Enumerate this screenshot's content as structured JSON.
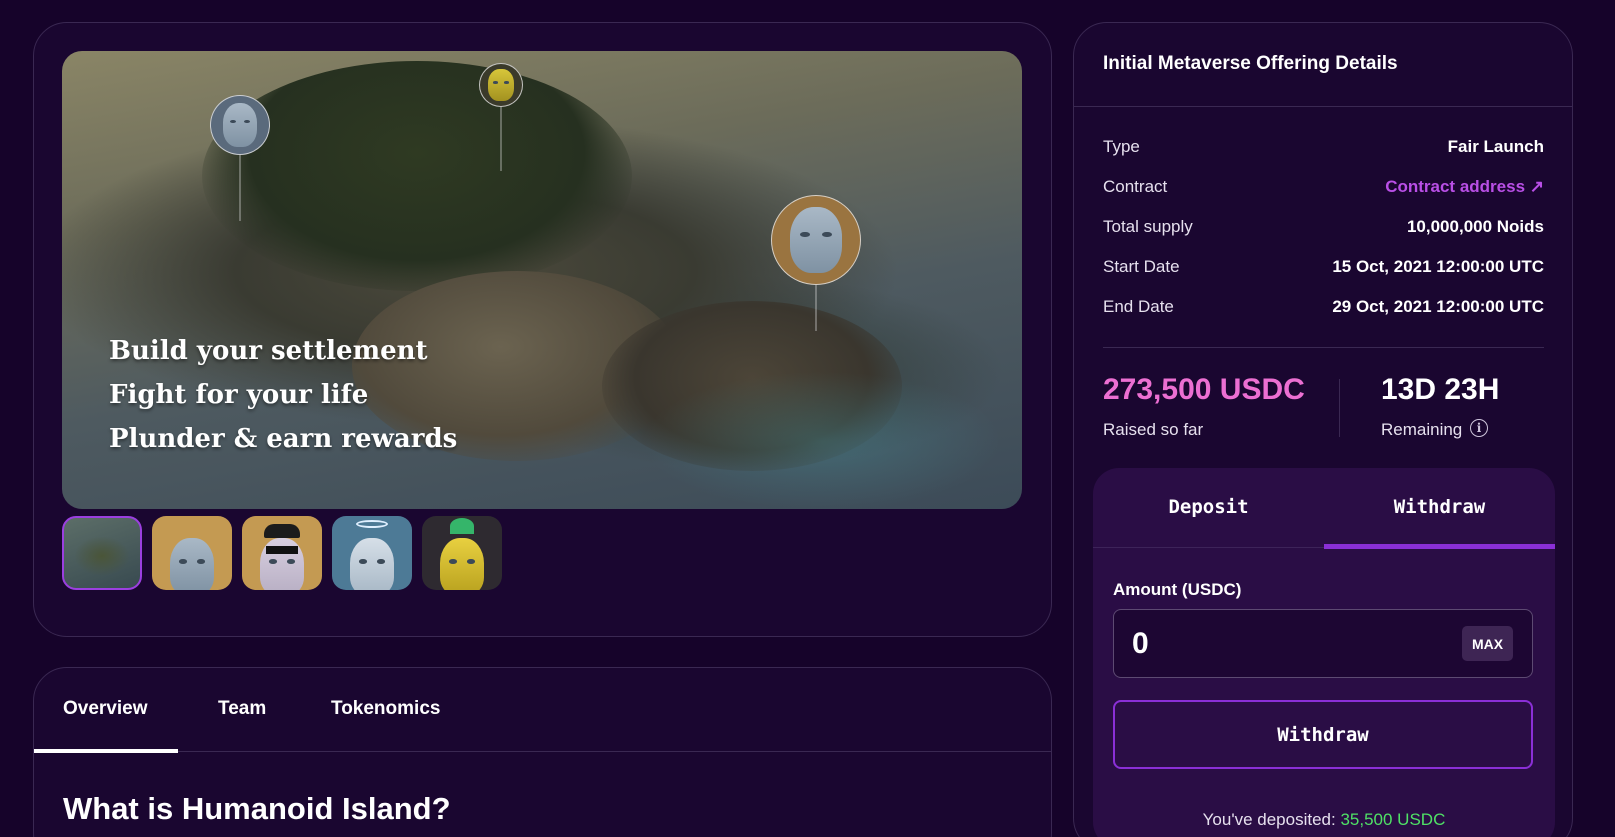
{
  "hero": {
    "tagline": [
      "Build your settlement",
      "Fight for your life",
      "Plunder & earn rewards"
    ],
    "thumbnails": [
      {
        "name": "island",
        "bg": "#4a5a55"
      },
      {
        "name": "humanoid-bald",
        "bg": "#c49a52"
      },
      {
        "name": "humanoid-cap-glasses",
        "bg": "#c49a52"
      },
      {
        "name": "humanoid-halo",
        "bg": "#4d7a96"
      },
      {
        "name": "humanoid-yellow-diver",
        "bg": "#2e2a30"
      }
    ]
  },
  "overview": {
    "tabs": [
      "Overview",
      "Team",
      "Tokenomics"
    ],
    "active_tab": "Overview",
    "heading": "What is Humanoid Island?"
  },
  "offering": {
    "title": "Initial Metaverse Offering Details",
    "details": [
      {
        "label": "Type",
        "value": "Fair Launch"
      },
      {
        "label": "Contract",
        "value": "Contract address ↗"
      },
      {
        "label": "Total supply",
        "value": "10,000,000 Noids"
      },
      {
        "label": "Start Date",
        "value": "15 Oct, 2021 12:00:00 UTC"
      },
      {
        "label": "End Date",
        "value": "29 Oct, 2021 12:00:00 UTC"
      }
    ],
    "raised": {
      "amount": "273,500 USDC",
      "label": "Raised so far"
    },
    "remaining": {
      "time": "13D 23H",
      "label": "Remaining",
      "info_icon": "i"
    }
  },
  "transaction": {
    "tabs": [
      "Deposit",
      "Withdraw"
    ],
    "active_tab": "Withdraw",
    "amount_label": "Amount (USDC)",
    "amount_value": "0",
    "max_label": "MAX",
    "submit_label": "Withdraw",
    "deposited_prefix": "You've deposited: ",
    "deposited_amount": "35,500 USDC"
  },
  "colors": {
    "background": "#16032a",
    "accent_purple": "#8a2fd6",
    "link": "#b94fe6",
    "raised_pink": "#ec6fd2",
    "deposited_green": "#4fe066"
  }
}
